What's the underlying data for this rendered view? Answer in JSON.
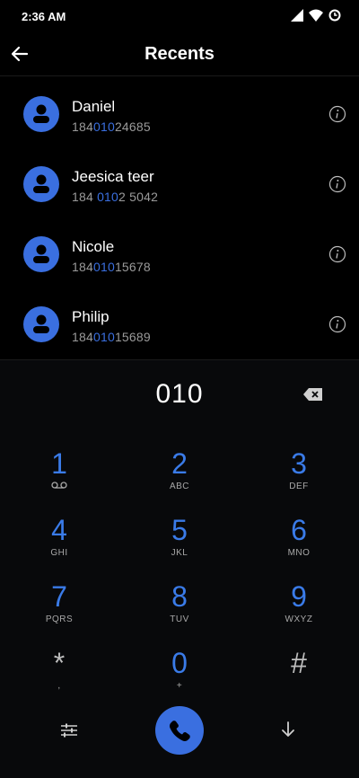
{
  "status": {
    "time": "2:36 AM"
  },
  "appbar": {
    "title": "Recents"
  },
  "recents": [
    {
      "name": "Daniel",
      "number_pre": "184",
      "number_hl": "010",
      "number_post": "24685"
    },
    {
      "name": "Jeesica teer",
      "number_pre": "184 ",
      "number_hl": "010",
      "number_post": "2 5042"
    },
    {
      "name": "Nicole",
      "number_pre": "184",
      "number_hl": "010",
      "number_post": "15678"
    },
    {
      "name": "Philip",
      "number_pre": "184",
      "number_hl": "010",
      "number_post": "15689"
    }
  ],
  "dialer": {
    "entered": "010",
    "keys": [
      {
        "digit": "1",
        "letters": ""
      },
      {
        "digit": "2",
        "letters": "ABC"
      },
      {
        "digit": "3",
        "letters": "DEF"
      },
      {
        "digit": "4",
        "letters": "GHI"
      },
      {
        "digit": "5",
        "letters": "JKL"
      },
      {
        "digit": "6",
        "letters": "MNO"
      },
      {
        "digit": "7",
        "letters": "PQRS"
      },
      {
        "digit": "8",
        "letters": "TUV"
      },
      {
        "digit": "9",
        "letters": "WXYZ"
      },
      {
        "digit": "*",
        "letters": ","
      },
      {
        "digit": "0",
        "letters": "+"
      },
      {
        "digit": "#",
        "letters": ""
      }
    ]
  },
  "colors": {
    "accent": "#3a6fe0",
    "background": "#000000",
    "secondary_text": "#9a9a9a"
  },
  "icons": {
    "status": [
      "signal-icon",
      "wifi-icon",
      "data-saver-icon"
    ],
    "appbar": "back-arrow-icon",
    "row_action": "info-icon",
    "avatar": "person-icon",
    "backspace": "backspace-icon",
    "voicemail": "voicemail-icon",
    "settings": "tune-icon",
    "call": "phone-icon",
    "collapse": "arrow-down-icon"
  }
}
